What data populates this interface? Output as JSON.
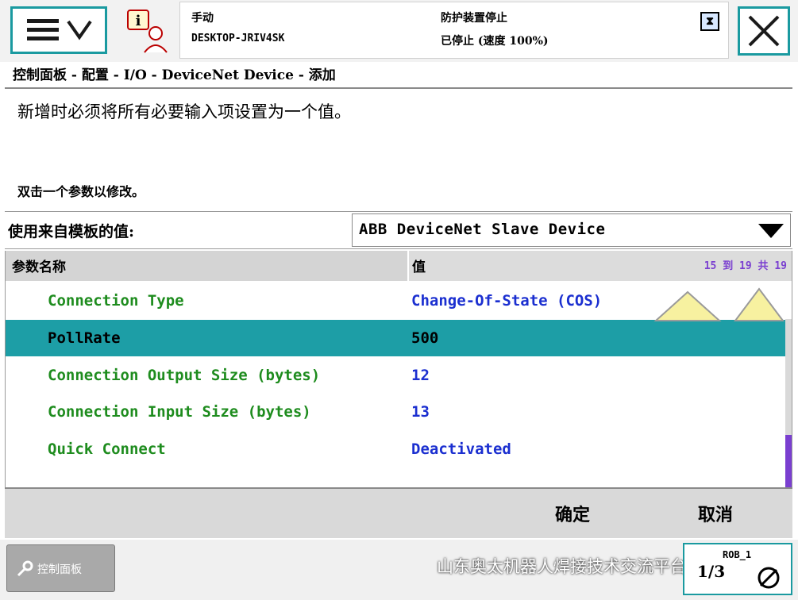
{
  "header": {
    "mode": "手动",
    "hostname": "DESKTOP-JRIV4SK",
    "guard_status": "防护装置停止",
    "run_state": "已停止 (速度 100%)"
  },
  "breadcrumb": "控制面板 - 配置 - I/O - DeviceNet Device - 添加",
  "instruction": "新增时必须将所有必要输入项设置为一个值。",
  "hint": "双击一个参数以修改。",
  "template": {
    "label": "使用来自模板的值:",
    "selected": "ABB DeviceNet Slave Device"
  },
  "table": {
    "col_name": "参数名称",
    "col_value": "值",
    "range": "15 到 19 共 19",
    "rows": [
      {
        "name": "Connection Type",
        "value": "Change-Of-State (COS)",
        "selected": false
      },
      {
        "name": "PollRate",
        "value": "500",
        "selected": true
      },
      {
        "name": "Connection Output Size (bytes)",
        "value": "12",
        "selected": false
      },
      {
        "name": "Connection Input Size (bytes)",
        "value": "13",
        "selected": false
      },
      {
        "name": "Quick Connect",
        "value": "Deactivated",
        "selected": false
      }
    ]
  },
  "actions": {
    "ok": "确定",
    "cancel": "取消"
  },
  "taskbar": {
    "control_panel": "控制面板",
    "robot": "ROB_1",
    "robot_fraction": "1/3",
    "watermark": "山东奥太机器人焊接技术交流平台"
  },
  "colors": {
    "accent_teal": "#1d9ea6",
    "param_green": "#1e8c1e",
    "value_blue": "#1b2fd0",
    "scroll_purple": "#7a3fd0"
  },
  "icons": {
    "menu": "hamburger-chevron-icon",
    "info": "info-user-icon",
    "system": "hourglass-status-icon",
    "close": "close-icon",
    "dropdown": "triangle-down-icon",
    "scroll_up": "triangle-up-icon",
    "control_panel": "wrench-icon",
    "robot": "jog-icon"
  }
}
